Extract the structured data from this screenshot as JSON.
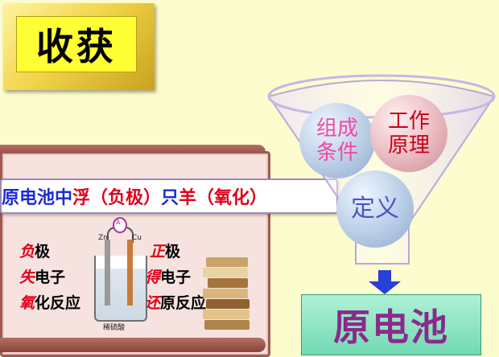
{
  "title": "收获",
  "ribbon": {
    "parts": [
      {
        "text": "原电池中",
        "color": "blue"
      },
      {
        "text": "浮（负极）",
        "color": "red"
      },
      {
        "text": "只",
        "color": "blue"
      },
      {
        "text": "羊（氧化）",
        "color": "red"
      }
    ]
  },
  "left_labels": {
    "line1_red": "负",
    "line1_black": "极",
    "line2_red": "失",
    "line2_black": "电子",
    "line3_red": "氧",
    "line3_black": "化反应"
  },
  "right_labels": {
    "line1_red": "正",
    "line1_black": "极",
    "line2_red": "得",
    "line2_black": "电子",
    "line3_red": "还",
    "line3_black": "原反应"
  },
  "diagram": {
    "zn_label": "Zn",
    "cu_label": "Cu",
    "meter_label": "A",
    "solution_label": "稀硫酸"
  },
  "funnel": {
    "circle_a": {
      "line1": "组成",
      "line2": "条件"
    },
    "circle_b": {
      "line1": "工作",
      "line2": "原理"
    },
    "circle_c": {
      "line1": "定义"
    }
  },
  "result": "原电池",
  "colors": {
    "background": "#fdfcce",
    "title_fill": "#ffff33",
    "accent_blue": "#1c2bd4",
    "accent_red": "#e0001b",
    "result_text": "#8b2a8b"
  }
}
